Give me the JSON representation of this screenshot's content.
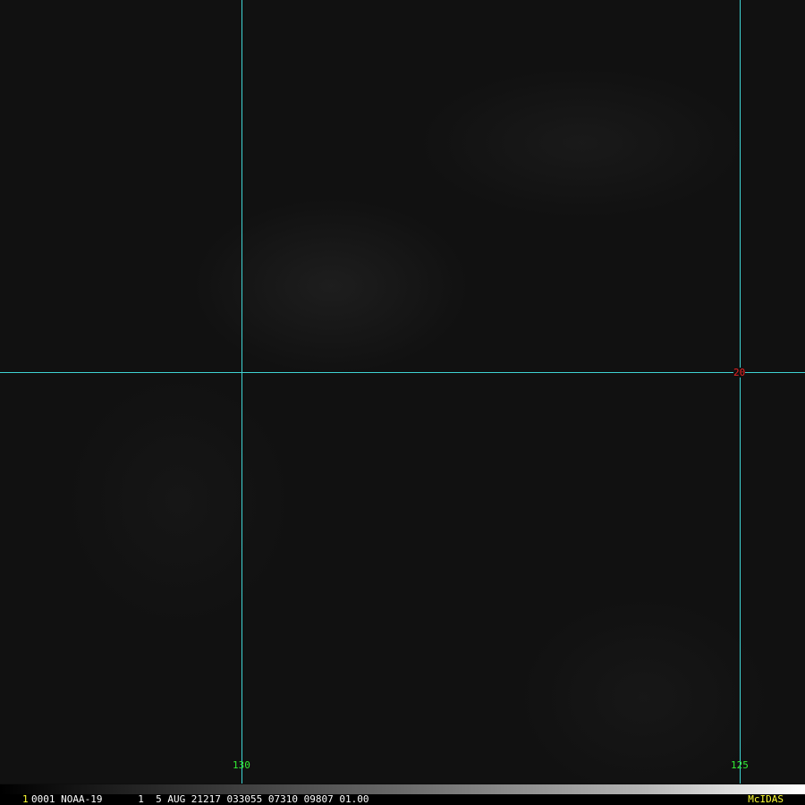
{
  "image": {
    "grid_color": "#3fd3d3",
    "lon_label_color": "#33ee33",
    "lat_label_color": "#ee2222"
  },
  "grid": {
    "lon_130_label": "130",
    "lon_125_label": "125",
    "lat_20_label": "20"
  },
  "status_bar": {
    "frame_number": "1",
    "info": "0001 NOAA-19      1  5 AUG 21217 033055 07310 09807 01.00",
    "brand": "McIDAS",
    "frame_number_color": "#ffff33",
    "brand_color": "#ffff33"
  }
}
